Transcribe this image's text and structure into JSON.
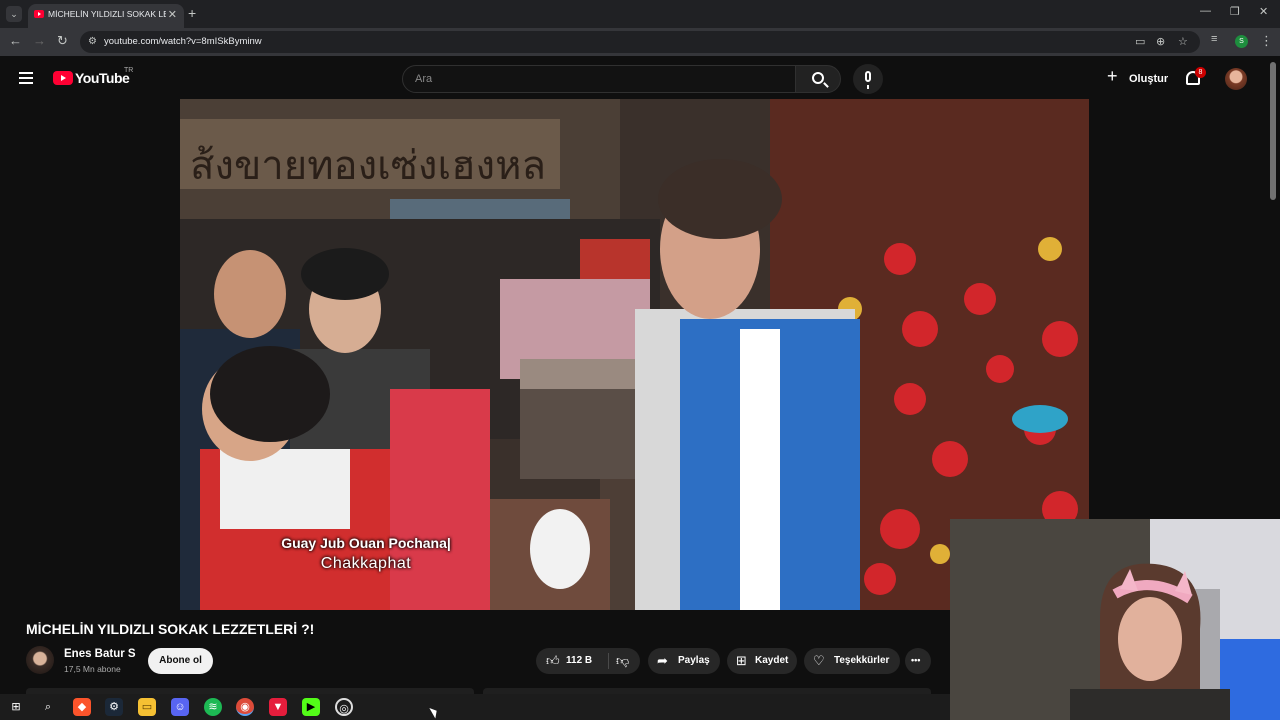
{
  "browser": {
    "tab_title": "MİCHELİN YILDIZLI SOKAK LEZZETLERİ ?!",
    "url": "youtube.com/watch?v=8mISkByminw"
  },
  "youtube": {
    "logo_text": "YouTube",
    "country_code": "TR",
    "search_placeholder": "Ara",
    "create_label": "Oluştur",
    "notification_count": "8"
  },
  "video": {
    "caption_line1": "Guay Jub Ouan Pochana|",
    "caption_line2": "Chakkaphat",
    "title": "MİCHELİN YILDIZLI SOKAK LEZZETLERİ ?!"
  },
  "channel": {
    "name": "Enes Batur S",
    "subscribers": "17,5 Mn abone",
    "subscribe_label": "Abone ol"
  },
  "actions": {
    "like_count": "112 B",
    "share_label": "Paylaş",
    "save_label": "Kaydet",
    "thanks_label": "Teşekkürler",
    "more_label": "•••"
  },
  "colors": {
    "background": "#0f0f0f",
    "youtube_red": "#ff0033",
    "pill": "#272727"
  }
}
